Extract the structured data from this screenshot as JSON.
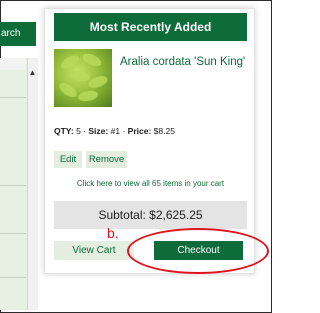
{
  "background": {
    "search_button_label": "arch",
    "scroll_up_icon": "▲"
  },
  "popup": {
    "header": "Most Recently Added",
    "item": {
      "image_icon": "plant-thumbnail",
      "name": "Aralia cordata 'Sun King'",
      "qty_label": "QTY:",
      "qty": "5",
      "size_label": "Size:",
      "size": "#1",
      "price_label": "Price:",
      "price": "$8.25",
      "edit_label": "Edit",
      "remove_label": "Remove"
    },
    "view_all_text": "Click here to view all 65 items in your cart",
    "subtotal_text": "Subtotal: $2,625.25",
    "view_cart_label": "View Cart",
    "checkout_label": "Checkout"
  },
  "annotation": {
    "label": "b.",
    "color": "#e0141e"
  },
  "colors": {
    "brand_green": "#0e6b3a",
    "light_green": "#e3ede0",
    "subtotal_bg": "#e4e4e4"
  }
}
